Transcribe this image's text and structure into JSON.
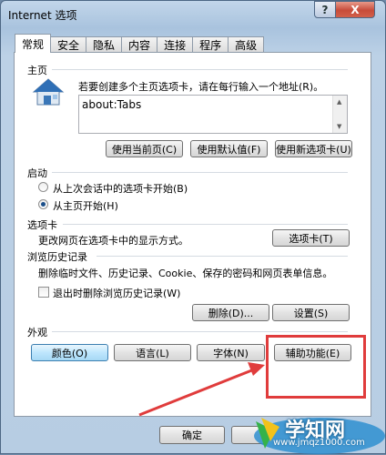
{
  "window": {
    "title": "Internet 选项",
    "help": "?",
    "close": "X"
  },
  "tabs": [
    {
      "label": "常规",
      "active": true
    },
    {
      "label": "安全"
    },
    {
      "label": "隐私"
    },
    {
      "label": "内容"
    },
    {
      "label": "连接"
    },
    {
      "label": "程序"
    },
    {
      "label": "高级"
    }
  ],
  "homepage": {
    "heading": "主页",
    "instruction": "若要创建多个主页选项卡，请在每行输入一个地址(R)。",
    "value": "about:Tabs",
    "btn_current": "使用当前页(C)",
    "btn_default": "使用默认值(F)",
    "btn_newtab": "使用新选项卡(U)"
  },
  "startup": {
    "heading": "启动",
    "option_last": "从上次会话中的选项卡开始(B)",
    "option_home": "从主页开始(H)"
  },
  "tabs_section": {
    "heading": "选项卡",
    "desc": "更改网页在选项卡中的显示方式。",
    "btn": "选项卡(T)"
  },
  "history": {
    "heading": "浏览历史记录",
    "desc": "删除临时文件、历史记录、Cookie、保存的密码和网页表单信息。",
    "checkbox": "退出时删除浏览历史记录(W)",
    "btn_delete": "删除(D)...",
    "btn_settings": "设置(S)"
  },
  "appearance": {
    "heading": "外观",
    "btn_colors": "颜色(O)",
    "btn_languages": "语言(L)",
    "btn_fonts": "字体(N)",
    "btn_accessibility": "辅助功能(E)"
  },
  "footer": {
    "ok": "确定"
  },
  "watermark": {
    "brand": "学知网",
    "url": "www.jmqz1000.com"
  }
}
